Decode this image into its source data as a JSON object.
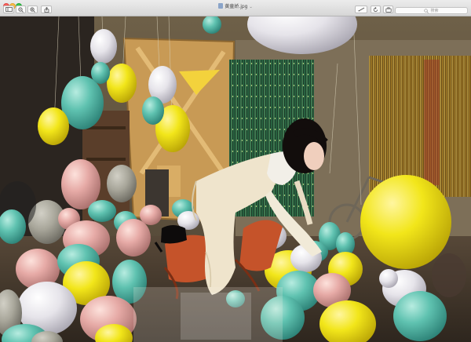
{
  "window": {
    "title": "黄童娇.jpg",
    "title_icon": "image-file-icon",
    "title_menu_icon": "chevron-down-icon"
  },
  "toolbar": {
    "left_buttons": [
      {
        "icon": "sidebar-toggle-icon"
      },
      {
        "icon": "zoom-out-icon"
      },
      {
        "icon": "zoom-in-icon"
      },
      {
        "icon": "share-icon"
      }
    ],
    "right_buttons": [
      {
        "icon": "markup-pen-icon"
      },
      {
        "icon": "rotate-icon"
      },
      {
        "icon": "toolbox-icon"
      }
    ],
    "search_placeholder": "搜索"
  },
  "photo": {
    "description_icon": "photo-image",
    "colors": {
      "wall": "#7a6a4e",
      "floor": "#3a3026",
      "door": "#c89a55",
      "curtain_green": "#3f8f5a",
      "curtain_gold": "#c8a040",
      "yellow_balloon": "#f2e61a",
      "teal_balloon": "#5fc2b0",
      "pink_balloon": "#e6aaa6",
      "chair": "#c5532a"
    }
  }
}
